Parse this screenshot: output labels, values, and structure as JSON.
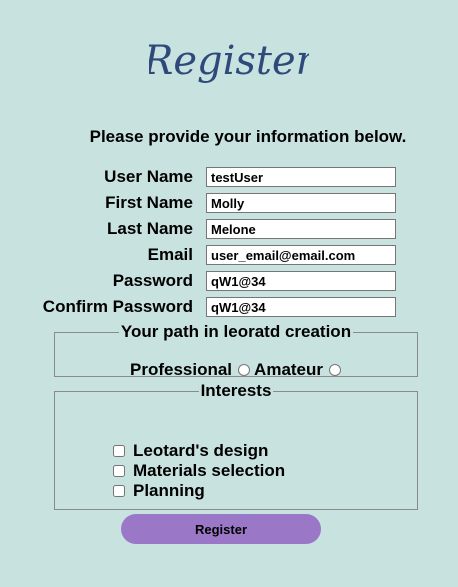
{
  "header": {
    "title": "Register"
  },
  "intro_text": "Please provide your information below.",
  "fields": {
    "username": {
      "label": "User Name",
      "value": "testUser"
    },
    "firstname": {
      "label": "First Name",
      "value": "Molly"
    },
    "lastname": {
      "label": "Last Name",
      "value": "Melone"
    },
    "email": {
      "label": "Email",
      "value": "user_email@email.com"
    },
    "password": {
      "label": "Password",
      "value": "qW1@34"
    },
    "confirm": {
      "label": "Confirm Password",
      "value": "qW1@34"
    }
  },
  "path": {
    "legend": "Your path in leoratd creation",
    "options": [
      "Professional",
      "Amateur"
    ]
  },
  "interests": {
    "legend": "Interests",
    "items": [
      "Leotard's design",
      "Materials selection",
      "Planning"
    ]
  },
  "submit_label": "Register",
  "colors": {
    "background": "#c8e3df",
    "button": "#9b78c7",
    "logo": "#2f4a7a"
  }
}
